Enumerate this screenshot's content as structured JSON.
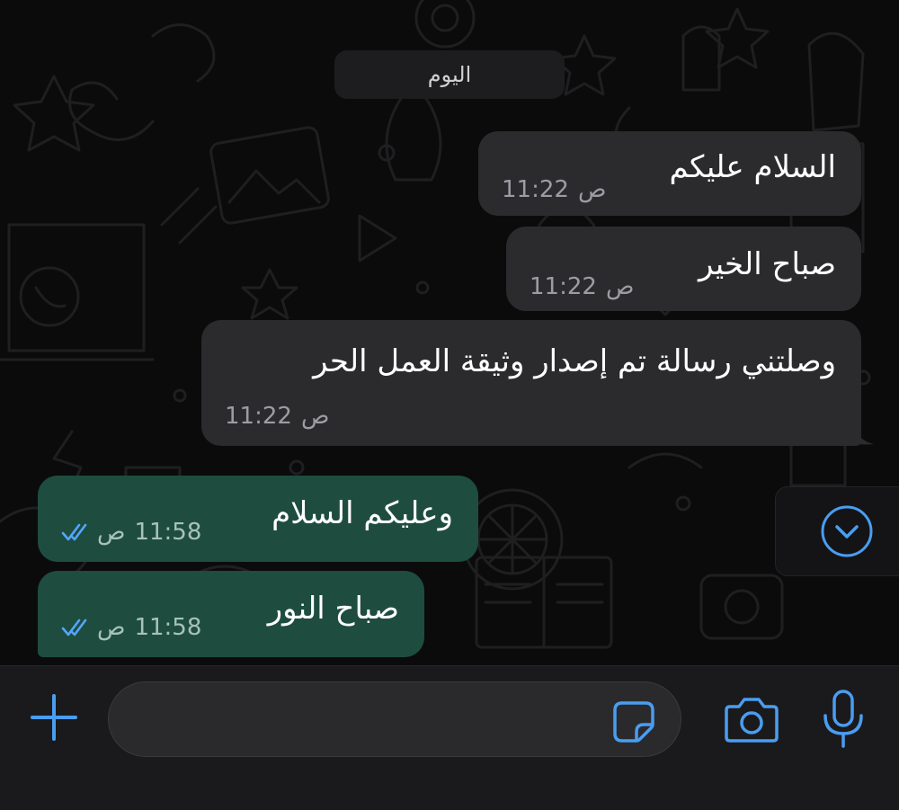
{
  "chat": {
    "date_divider": "اليوم",
    "messages": [
      {
        "direction": "incoming",
        "text": "السلام عليكم",
        "time": "11:22",
        "ampm": "ص"
      },
      {
        "direction": "incoming",
        "text": "صباح الخير",
        "time": "11:22",
        "ampm": "ص"
      },
      {
        "direction": "incoming",
        "text": "وصلتني رسالة تم إصدار وثيقة العمل الحر",
        "time": "11:22",
        "ampm": "ص"
      },
      {
        "direction": "outgoing",
        "text": "وعليكم السلام",
        "time": "11:58",
        "ampm": "ص",
        "status": "read"
      },
      {
        "direction": "outgoing",
        "text": "صباح النور",
        "time": "11:58",
        "ampm": "ص",
        "status": "read"
      }
    ]
  },
  "input_bar": {
    "placeholder": "",
    "value": ""
  },
  "icons": {
    "attach": "plus-icon",
    "sticker": "sticker-icon",
    "camera": "camera-icon",
    "mic": "microphone-icon",
    "scroll": "chevron-down-circle-icon",
    "read_receipt": "double-check-icon"
  },
  "colors": {
    "background": "#0b0b0b",
    "incoming_bubble": "#2b2b2e",
    "outgoing_bubble": "#1e4d40",
    "accent": "#4a9df0",
    "read_tick": "#53a6ff"
  }
}
